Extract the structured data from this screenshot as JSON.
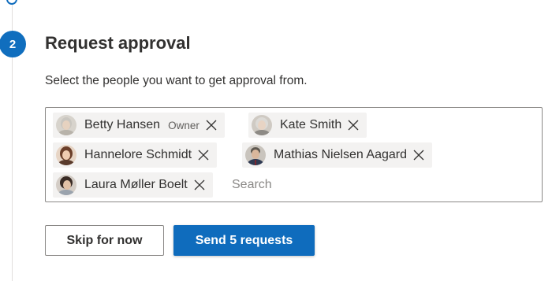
{
  "step": {
    "number": "2",
    "title": "Request approval",
    "instruction": "Select the people you want to get approval from."
  },
  "people": [
    {
      "name": "Betty Hansen",
      "role": "Owner",
      "avatar_icon": "avatar-betty-hansen"
    },
    {
      "name": "Kate Smith",
      "role": "",
      "avatar_icon": "avatar-kate-smith"
    },
    {
      "name": "Hannelore Schmidt",
      "role": "",
      "avatar_icon": "avatar-hannelore-schmidt"
    },
    {
      "name": "Mathias Nielsen Aagard",
      "role": "",
      "avatar_icon": "avatar-mathias-nielsen-aagard"
    },
    {
      "name": "Laura Møller Boelt",
      "role": "",
      "avatar_icon": "avatar-laura-moller-boelt"
    }
  ],
  "search": {
    "placeholder": "Search",
    "value": ""
  },
  "actions": {
    "skip_label": "Skip for now",
    "send_label": "Send 5 requests"
  },
  "colors": {
    "accent": "#0f6cbd",
    "chip_background": "#f3f2f1",
    "border": "#8a8886"
  }
}
